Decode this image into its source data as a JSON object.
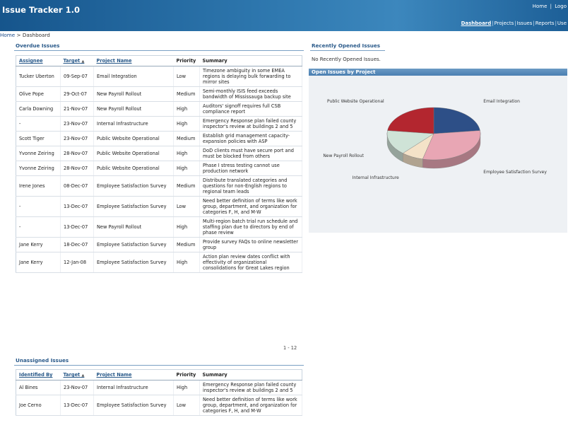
{
  "header": {
    "app_title": "Issue Tracker 1.0",
    "global_links": {
      "home": "Home",
      "sep": "|",
      "logout": "Logo"
    },
    "tabs": [
      "Dashboard",
      "Projects",
      "Issues",
      "Reports",
      "Use"
    ]
  },
  "breadcrumb": {
    "home": "Home",
    "sep": ">",
    "current": "Dashboard"
  },
  "overdue": {
    "title": "Overdue Issues",
    "columns": [
      "Assignee",
      "Target",
      "Project Name",
      "Priority",
      "Summary"
    ],
    "rows": [
      [
        "Tucker Uberton",
        "09-Sep-07",
        "Email Integration",
        "Low",
        "Timezone ambiguity in some EMEA regions is delaying bulk forwarding to mirror sites"
      ],
      [
        "Olive Pope",
        "29-Oct-07",
        "New Payroll Rollout",
        "Medium",
        "Semi-monthly ISIS feed exceeds bandwidth of Mississauga backup site"
      ],
      [
        "Carla Downing",
        "21-Nov-07",
        "New Payroll Rollout",
        "High",
        "Auditors' signoff requires full CSB compliance report"
      ],
      [
        "-",
        "23-Nov-07",
        "Internal Infrastructure",
        "High",
        "Emergency Response plan failed county inspector's review at buildings 2 and 5"
      ],
      [
        "Scott Tiger",
        "23-Nov-07",
        "Public Website Operational",
        "Medium",
        "Establish grid management capacity-expansion policies with ASP"
      ],
      [
        "Yvonne Zeiring",
        "28-Nov-07",
        "Public Website Operational",
        "High",
        "DoD clients must have secure port and must be blocked from others"
      ],
      [
        "Yvonne Zeiring",
        "28-Nov-07",
        "Public Website Operational",
        "High",
        "Phase I stress testing cannot use production network"
      ],
      [
        "Irene Jones",
        "08-Dec-07",
        "Employee Satisfaction Survey",
        "Medium",
        "Distribute translated categories and questions for non-English regions to regional team leads"
      ],
      [
        "-",
        "13-Dec-07",
        "Employee Satisfaction Survey",
        "Low",
        "Need better definition of terms like work group, department, and organization for categories F, H, and M-W"
      ],
      [
        "-",
        "13-Dec-07",
        "New Payroll Rollout",
        "High",
        "Multi-region batch trial run schedule and staffing plan due to directors by end of phase review"
      ],
      [
        "Jane Kerry",
        "18-Dec-07",
        "Employee Satisfaction Survey",
        "Medium",
        "Provide survey FAQs to online newsletter group"
      ],
      [
        "Jane Kerry",
        "12-Jan-08",
        "Employee Satisfaction Survey",
        "High",
        "Action plan review dates conflict with effectivity of organizational consolidations for Great Lakes region"
      ]
    ],
    "pager": "1 - 12"
  },
  "unassigned": {
    "title": "Unassigned Issues",
    "columns": [
      "Identified By",
      "Target",
      "Project Name",
      "Priority",
      "Summary"
    ],
    "rows": [
      [
        "Al Bines",
        "23-Nov-07",
        "Internal Infrastructure",
        "High",
        "Emergency Response plan failed county inspector's review at buildings 2 and 5"
      ],
      [
        "Joe Cerno",
        "13-Dec-07",
        "Employee Satisfaction Survey",
        "Low",
        "Need better definition of terms like work group, department, and organization for categories F, H, and M-W"
      ]
    ]
  },
  "recent": {
    "title": "Recently Opened Issues",
    "empty_text": "No Recently Opened Issues."
  },
  "open_by_project": {
    "title": "Open Issues by Project"
  },
  "sort_indicator": "▲",
  "colors": {
    "header": "#1d5f97",
    "accent": "#2a5a8a",
    "chart_panel": "#eef1f4"
  },
  "chart_data": {
    "type": "pie",
    "title": "",
    "categories": [
      "Email Integration",
      "Employee Satisfaction Survey",
      "Internal Infrastructure",
      "New Payroll Rollout",
      "Public Website Operational"
    ],
    "values": [
      3,
      4,
      1,
      2,
      3
    ],
    "colors": [
      "#2d4f87",
      "#e8a6b4",
      "#f4e2c8",
      "#cfe3d7",
      "#b3262f"
    ]
  }
}
